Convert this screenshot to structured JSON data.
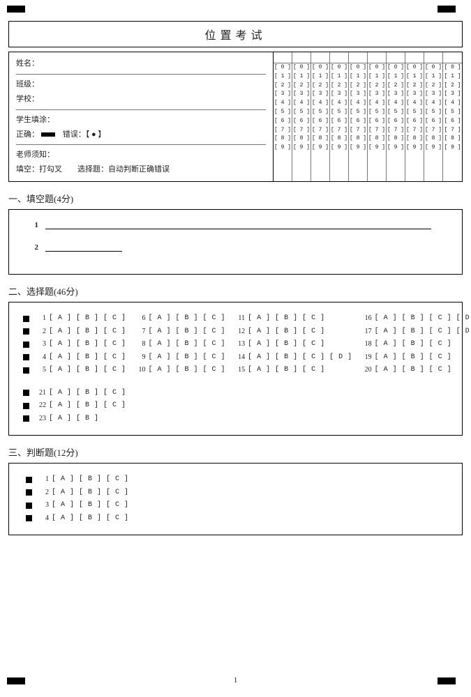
{
  "header": {
    "title": "位置考试"
  },
  "info": {
    "name_label": "姓名：",
    "class_label": "班级：",
    "school_label": "学校：",
    "student_fill_label": "学生填涂：",
    "correct_label": "正确：",
    "wrong_label": "错误：【 ● 】",
    "teacher_note_label": "老师须知：",
    "teacher_note_content": "填空：打勾叉　　选择题：自动判断正确错误"
  },
  "id_digits": [
    "[ 0 ]",
    "[ 1 ]",
    "[ 2 ]",
    "[ 3 ]",
    "[ 4 ]",
    "[ 5 ]",
    "[ 6 ]",
    "[ 7 ]",
    "[ 8 ]",
    "[ 9 ]"
  ],
  "sections": {
    "fill": {
      "title": "一、填空题(4分)",
      "items": [
        "1",
        "2"
      ]
    },
    "choice": {
      "title": "二、选择题(46分)",
      "rows_grid": [
        [
          {
            "n": "1",
            "o": "[ A ] [ B ] [ C ]"
          },
          {
            "n": "6",
            "o": "[ A ] [ B ] [ C ]"
          },
          {
            "n": "11",
            "o": "[ A ] [ B ] [ C ]"
          },
          {
            "n": "16",
            "o": "[ A ] [ B ] [ C ] [ D ]"
          }
        ],
        [
          {
            "n": "2",
            "o": "[ A ] [ B ] [ C ]"
          },
          {
            "n": "7",
            "o": "[ A ] [ B ] [ C ]"
          },
          {
            "n": "12",
            "o": "[ A ] [ B ] [ C ]"
          },
          {
            "n": "17",
            "o": "[ A ] [ B ] [ C ] [ D ]"
          }
        ],
        [
          {
            "n": "3",
            "o": "[ A ] [ B ] [ C ]"
          },
          {
            "n": "8",
            "o": "[ A ] [ B ] [ C ]"
          },
          {
            "n": "13",
            "o": "[ A ] [ B ] [ C ]"
          },
          {
            "n": "18",
            "o": "[ A ] [ B ] [ C ]"
          }
        ],
        [
          {
            "n": "4",
            "o": "[ A ] [ B ] [ C ]"
          },
          {
            "n": "9",
            "o": "[ A ] [ B ] [ C ]"
          },
          {
            "n": "14",
            "o": "[ A ] [ B ] [ C ] [ D ]"
          },
          {
            "n": "19",
            "o": "[ A ] [ B ] [ C ]"
          }
        ],
        [
          {
            "n": "5",
            "o": "[ A ] [ B ] [ C ]"
          },
          {
            "n": "10",
            "o": "[ A ] [ B ] [ C ]"
          },
          {
            "n": "15",
            "o": "[ A ] [ B ] [ C ]"
          },
          {
            "n": "20",
            "o": "[ A ] [ B ] [ C ]"
          }
        ]
      ],
      "extra": [
        {
          "n": "21",
          "o": "[ A ] [ B ] [ C ]"
        },
        {
          "n": "22",
          "o": "[ A ] [ B ] [ C ]"
        },
        {
          "n": "23",
          "o": "[ A ] [ B ]"
        }
      ]
    },
    "judge": {
      "title": "三、判断题(12分)",
      "rows": [
        {
          "n": "1",
          "o": "[ A ] [ B ] [ C ]"
        },
        {
          "n": "2",
          "o": "[ A ] [ B ] [ C ]"
        },
        {
          "n": "3",
          "o": "[ A ] [ B ] [ C ]"
        },
        {
          "n": "4",
          "o": "[ A ] [ B ] [ C ]"
        }
      ]
    }
  },
  "page_number": "1"
}
